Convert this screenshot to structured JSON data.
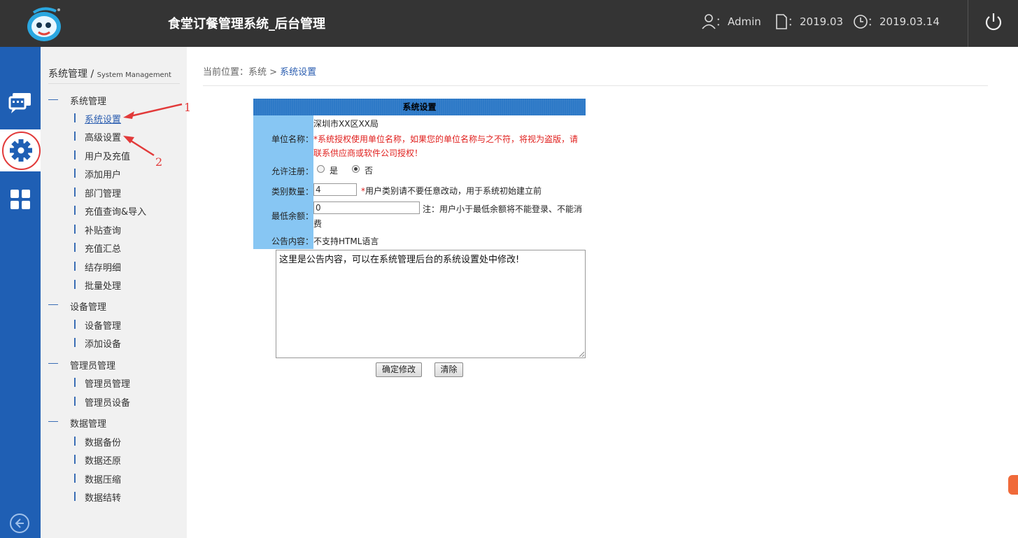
{
  "header": {
    "title": "食堂订餐管理系统_后台管理",
    "user": "Admin",
    "version": "2019.03",
    "date": "2019.03.14",
    "user_prefix": "：",
    "version_prefix": "：",
    "date_prefix": "："
  },
  "sidebar": {
    "title": "系统管理",
    "title_sep": "/",
    "title_en": "System Management",
    "groups": [
      {
        "label": "系统管理",
        "items": [
          "系统设置",
          "高级设置",
          "用户及充值",
          "添加用户",
          "部门管理",
          "充值查询&导入",
          "补贴查询",
          "充值汇总",
          "结存明细",
          "批量处理"
        ]
      },
      {
        "label": "设备管理",
        "items": [
          "设备管理",
          "添加设备"
        ]
      },
      {
        "label": "管理员管理",
        "items": [
          "管理员管理",
          "管理员设备"
        ]
      },
      {
        "label": "数据管理",
        "items": [
          "数据备份",
          "数据还原",
          "数据压缩",
          "数据结转"
        ]
      }
    ]
  },
  "breadcrumb": {
    "prefix": "当前位置：系统 >",
    "current": "系统设置"
  },
  "form": {
    "heading": "系统设置",
    "unit_label": "单位名称：",
    "unit_value": "深圳市XX区XX局",
    "unit_warning_line1": "*系统授权使用单位名称，如果您的单位名称与之不符，将视为盗版，请",
    "unit_warning_line2": "联系供应商或软件公司授权！",
    "register_label": "允许注册：",
    "register_yes": "是",
    "register_no": "否",
    "register_selected": "否",
    "category_label": "类别数量：",
    "category_value": "4",
    "category_note_star": "*",
    "category_note": "用户类别请不要任意改动，用于系统初始建立前",
    "min_balance_label": "最低余额：",
    "min_balance_value": "0",
    "min_balance_note_line1": "注：用户小于最低余额将不能登录、不能消",
    "min_balance_note_line2": "费",
    "notice_label": "公告内容：",
    "notice_hint": "不支持HTML语言",
    "notice_value": "这里是公告内容，可以在系统管理后台的系统设置处中修改!",
    "confirm_button": "确定修改",
    "clear_button": "清除"
  },
  "annotations": {
    "arrow1": "1",
    "arrow2": "2"
  },
  "colors": {
    "header_bg": "#343434",
    "iconbar_bg": "#1f5fb4",
    "label_bg": "#87c6f3",
    "table_head_bg": "#2d79c7",
    "accent_red": "#e23a3a"
  }
}
